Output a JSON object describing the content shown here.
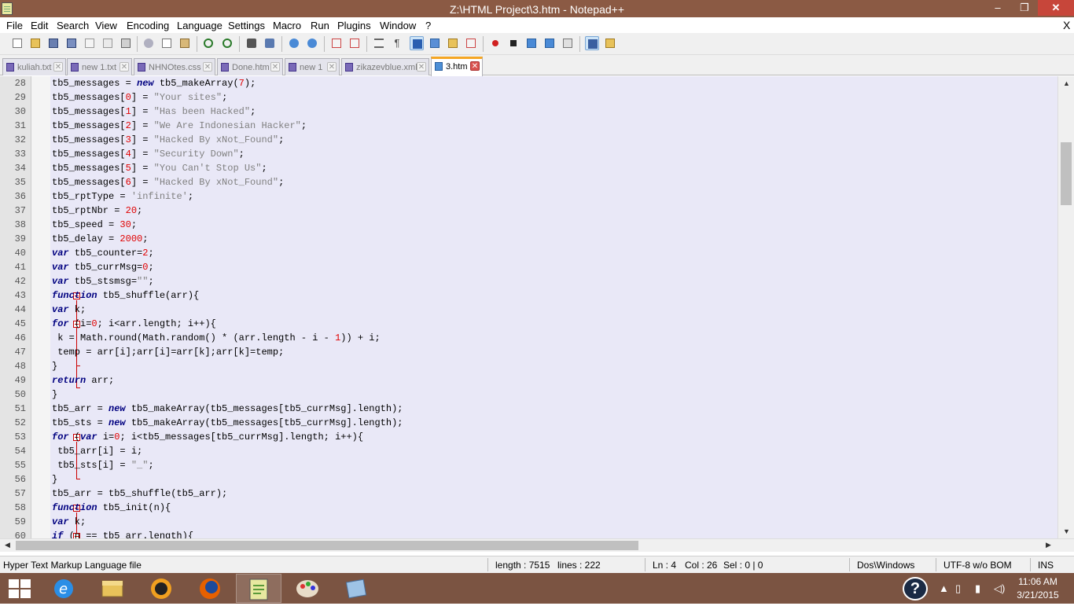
{
  "window": {
    "title": "Z:\\HTML Project\\3.htm - Notepad++",
    "min_glyph": "–",
    "max_glyph": "❐",
    "close_glyph": "✕"
  },
  "menu": {
    "items": [
      "File",
      "Edit",
      "Search",
      "View",
      "Encoding",
      "Language",
      "Settings",
      "Macro",
      "Run",
      "Plugins",
      "Window",
      "?"
    ],
    "close_glyph": "X"
  },
  "tabs": [
    {
      "label": "kuliah.txt",
      "active": false
    },
    {
      "label": "new   1.txt",
      "active": false
    },
    {
      "label": "NHNOtes.css",
      "active": false
    },
    {
      "label": "Done.htm",
      "active": false
    },
    {
      "label": "new   1",
      "active": false
    },
    {
      "label": "zikazevblue.xml",
      "active": false
    },
    {
      "label": "3.htm",
      "active": true
    }
  ],
  "tab_close_glyph": "✕",
  "editor": {
    "lines": [
      {
        "n": "28",
        "html": "tb5_messages = <span class=\"kw\">new</span> tb5_makeArray(<span class=\"num\">7</span>);"
      },
      {
        "n": "29",
        "html": "tb5_messages[<span class=\"num\">0</span>] = <span class=\"str\">\"Your sites\"</span>;"
      },
      {
        "n": "30",
        "html": "tb5_messages[<span class=\"num\">1</span>] = <span class=\"str\">\"Has been Hacked\"</span>;"
      },
      {
        "n": "31",
        "html": "tb5_messages[<span class=\"num\">2</span>] = <span class=\"str\">\"We Are Indonesian Hacker\"</span>;"
      },
      {
        "n": "32",
        "html": "tb5_messages[<span class=\"num\">3</span>] = <span class=\"str\">\"Hacked By xNot_Found\"</span>;"
      },
      {
        "n": "33",
        "html": "tb5_messages[<span class=\"num\">4</span>] = <span class=\"str\">\"Security Down\"</span>;"
      },
      {
        "n": "34",
        "html": "tb5_messages[<span class=\"num\">5</span>] = <span class=\"str\">\"You Can't Stop Us\"</span>;"
      },
      {
        "n": "35",
        "html": "tb5_messages[<span class=\"num\">6</span>] = <span class=\"str\">\"Hacked By xNot_Found\"</span>;"
      },
      {
        "n": "36",
        "html": "tb5_rptType = <span class=\"str\">'infinite'</span>;"
      },
      {
        "n": "37",
        "html": "tb5_rptNbr = <span class=\"num\">20</span>;"
      },
      {
        "n": "38",
        "html": "tb5_speed = <span class=\"num\">30</span>;"
      },
      {
        "n": "39",
        "html": "tb5_delay = <span class=\"num\">2000</span>;"
      },
      {
        "n": "40",
        "html": "<span class=\"kw\">var</span> tb5_counter=<span class=\"num\">2</span>;"
      },
      {
        "n": "41",
        "html": "<span class=\"kw\">var</span> tb5_currMsg=<span class=\"num\">0</span>;"
      },
      {
        "n": "42",
        "html": "<span class=\"kw\">var</span> tb5_stsmsg=<span class=\"str\">\"\"</span>;"
      },
      {
        "n": "43",
        "html": "<span class=\"kw\">function</span> tb5_shuffle(arr){"
      },
      {
        "n": "44",
        "html": "<span class=\"kw\">var</span> k;"
      },
      {
        "n": "45",
        "html": "<span class=\"kw\">for</span> (i=<span class=\"num\">0</span>; i&lt;arr.length; i++){"
      },
      {
        "n": "46",
        "html": " k = Math.round(Math.random() * (arr.length - i - <span class=\"num\">1</span>)) + i;"
      },
      {
        "n": "47",
        "html": " temp = arr[i];arr[i]=arr[k];arr[k]=temp;"
      },
      {
        "n": "48",
        "html": "}"
      },
      {
        "n": "49",
        "html": "<span class=\"kw\">return</span> arr;"
      },
      {
        "n": "50",
        "html": "}"
      },
      {
        "n": "51",
        "html": "tb5_arr = <span class=\"kw\">new</span> tb5_makeArray(tb5_messages[tb5_currMsg].length);"
      },
      {
        "n": "52",
        "html": "tb5_sts = <span class=\"kw\">new</span> tb5_makeArray(tb5_messages[tb5_currMsg].length);"
      },
      {
        "n": "53",
        "html": "<span class=\"kw\">for</span> (<span class=\"kw\">var</span> i=<span class=\"num\">0</span>; i&lt;tb5_messages[tb5_currMsg].length; i++){"
      },
      {
        "n": "54",
        "html": " tb5_arr[i] = i;"
      },
      {
        "n": "55",
        "html": " tb5_sts[i] = <span class=\"str\">\"_\"</span>;"
      },
      {
        "n": "56",
        "html": "}"
      },
      {
        "n": "57",
        "html": "tb5_arr = tb5_shuffle(tb5_arr);"
      },
      {
        "n": "58",
        "html": "<span class=\"kw\">function</span> tb5_init(n){"
      },
      {
        "n": "59",
        "html": "<span class=\"kw\">var</span> k;"
      },
      {
        "n": "60",
        "html": "<span class=\"kw\">if</span> (n == tb5_arr.length){"
      }
    ]
  },
  "status": {
    "file_type": "Hyper Text Markup Language file",
    "length": "length : 7515",
    "lines": "lines : 222",
    "ln": "Ln : 4",
    "col": "Col : 26",
    "sel": "Sel : 0 | 0",
    "eol": "Dos\\Windows",
    "encoding": "UTF-8 w/o BOM",
    "mode": "INS"
  },
  "taskbar": {
    "time": "11:06 AM",
    "date": "3/21/2015"
  },
  "colors": {
    "titlebar": "#8b5a44",
    "editor_bg": "#e9e8f7",
    "keyword": "#000080",
    "number": "#e00000",
    "string": "#808080",
    "taskbar": "#7b5442"
  }
}
